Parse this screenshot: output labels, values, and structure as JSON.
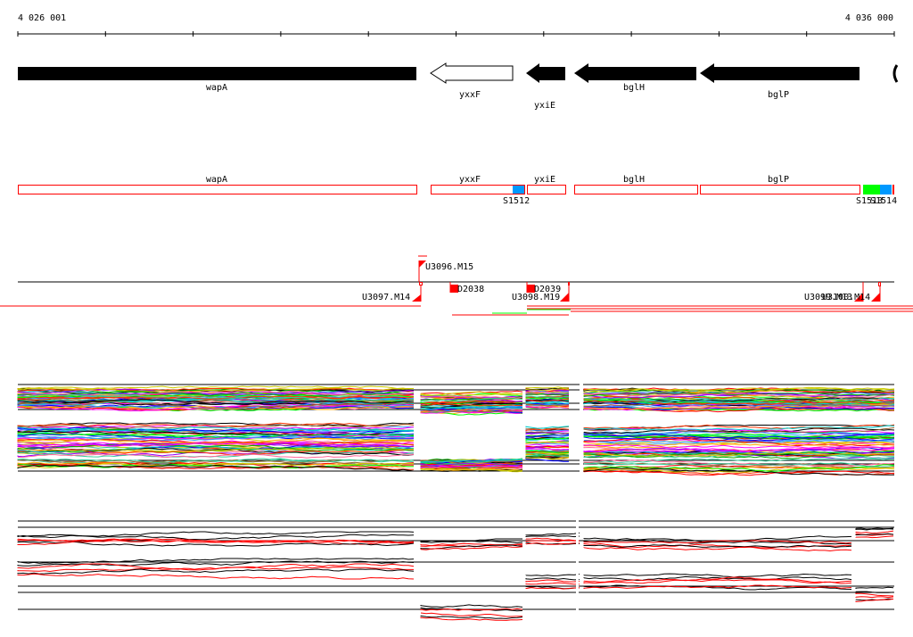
{
  "coordinates": {
    "start": "4 026 001",
    "end": "4 036 000",
    "start_value": 4026001,
    "end_value": 4036000
  },
  "genes": [
    {
      "name": "wapA",
      "from": 4026001,
      "to": 4030550,
      "strand": "-",
      "filled": true
    },
    {
      "name": "yxxF",
      "from": 4030710,
      "to": 4031650,
      "strand": "-",
      "filled": false
    },
    {
      "name": "yxiE",
      "from": 4031800,
      "to": 4032250,
      "strand": "-",
      "filled": true
    },
    {
      "name": "bglH",
      "from": 4032350,
      "to": 4033740,
      "strand": "-",
      "filled": true
    },
    {
      "name": "bglP",
      "from": 4033790,
      "to": 4035610,
      "strand": "-",
      "filled": true
    }
  ],
  "transcripts": [
    {
      "name": "wapA"
    },
    {
      "name": "yxxF"
    },
    {
      "name": "yxiE"
    },
    {
      "name": "bglH"
    },
    {
      "name": "bglP"
    }
  ],
  "segments": [
    {
      "name": "S1512"
    },
    {
      "name": "S1513"
    },
    {
      "name": "S1514"
    }
  ],
  "features": [
    {
      "name": "U3096.M15"
    },
    {
      "name": "U3097.M14"
    },
    {
      "name": "D2038"
    },
    {
      "name": "D2039"
    },
    {
      "name": "U3098.M19"
    },
    {
      "name": "U3099.M13"
    },
    {
      "name": "U3100.M14"
    }
  ],
  "colors": {
    "transcript": "#ff0000",
    "segment_blue": "#0099ff",
    "segment_green": "#00ff00"
  }
}
